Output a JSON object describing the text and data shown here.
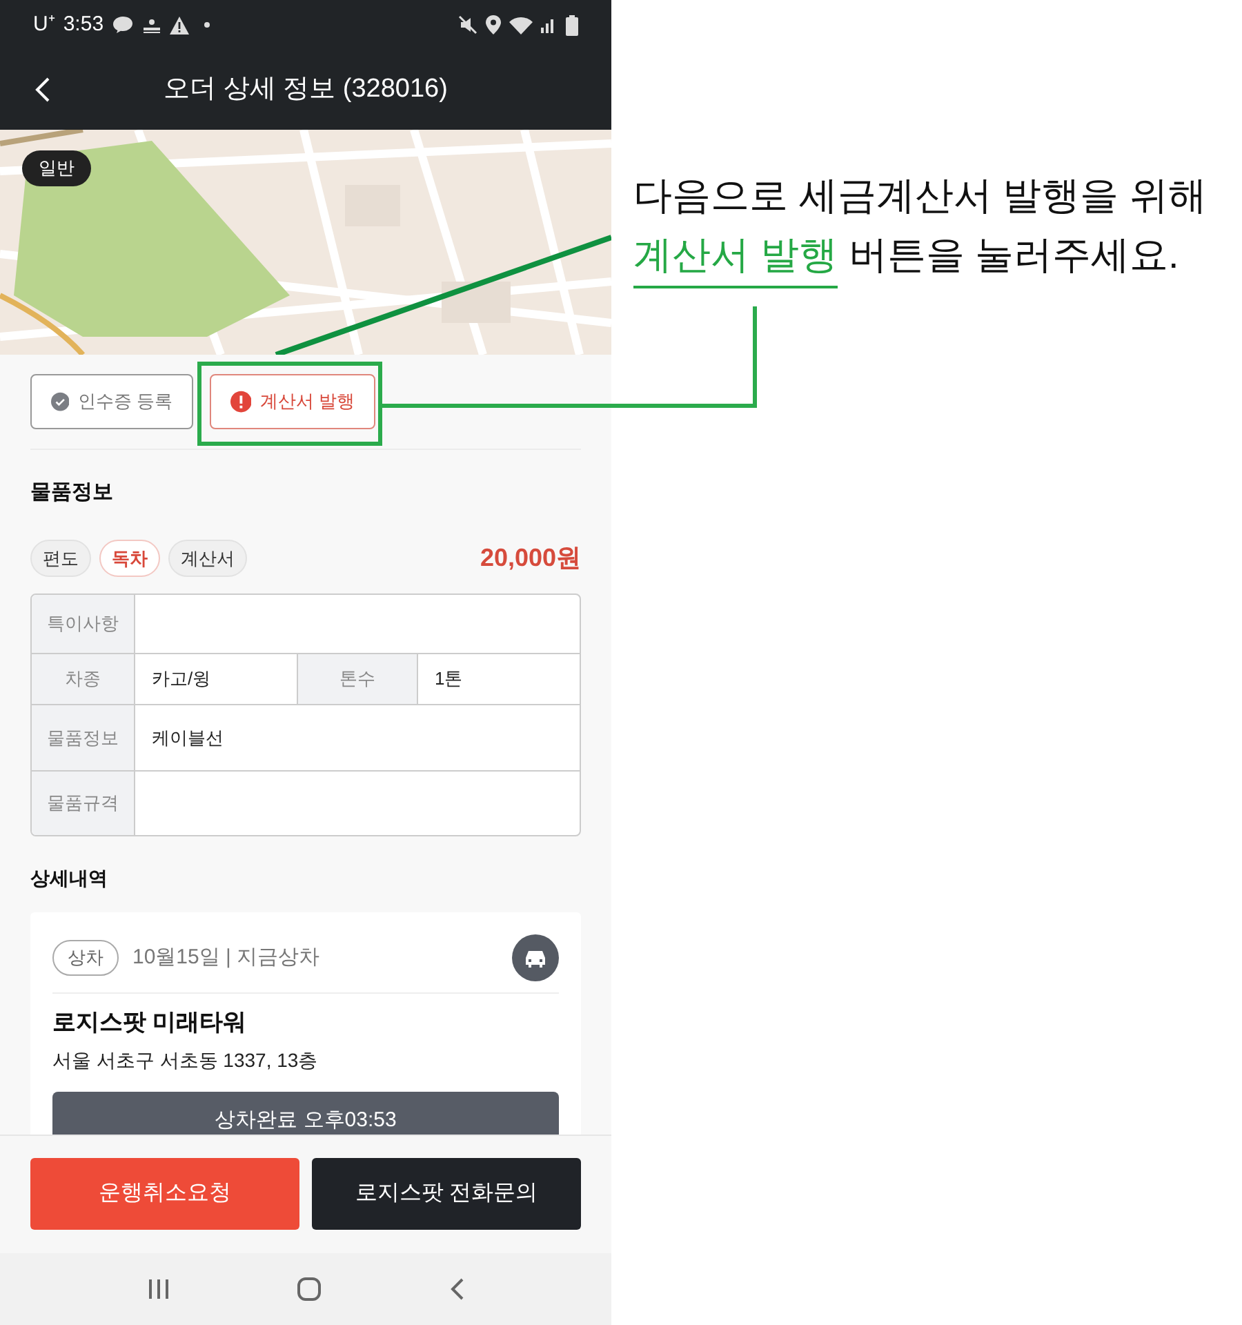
{
  "status_bar": {
    "carrier": "U⁺",
    "time": "3:53"
  },
  "header": {
    "title": "오더 상세 정보 (328016)"
  },
  "map": {
    "kind": "picture",
    "badge": "일반"
  },
  "action_buttons": [
    {
      "label": "인수증 등록",
      "kind": "done"
    },
    {
      "label": "계산서 발행",
      "kind": "alert"
    }
  ],
  "goods_section": {
    "title": "물품정보",
    "tags": [
      {
        "label": "편도",
        "selected": false
      },
      {
        "label": "독차",
        "selected": true
      },
      {
        "label": "계산서",
        "selected": false
      }
    ],
    "price": "20,000원",
    "table": [
      [
        {
          "label": "특이사항"
        }
      ],
      [
        {
          "label": "차종",
          "value": "카고/윙"
        },
        {
          "label": "톤수",
          "value": "1톤"
        }
      ],
      [
        {
          "label": "물품정보",
          "value": "케이블선"
        }
      ],
      [
        {
          "label": "물품규격"
        }
      ]
    ]
  },
  "detail_section": {
    "title": "상세내역",
    "stop": {
      "type": "상차",
      "date": "10월15일 | 지금상차",
      "name": "로지스팟 미래타워",
      "address": "서울 서초구 서초동 1337, 13층",
      "status_button": "상차완료 오후03:53"
    }
  },
  "bottom_buttons": [
    {
      "label": "운행취소요청",
      "kind": "danger"
    },
    {
      "label": "로지스팟 전화문의",
      "kind": "dark"
    }
  ],
  "callout": {
    "line_1": "다음으로 세금계산서 발행을 위해",
    "highlight": "계산서 발행",
    "line_2_rest": "버튼을 눌러주세요."
  }
}
